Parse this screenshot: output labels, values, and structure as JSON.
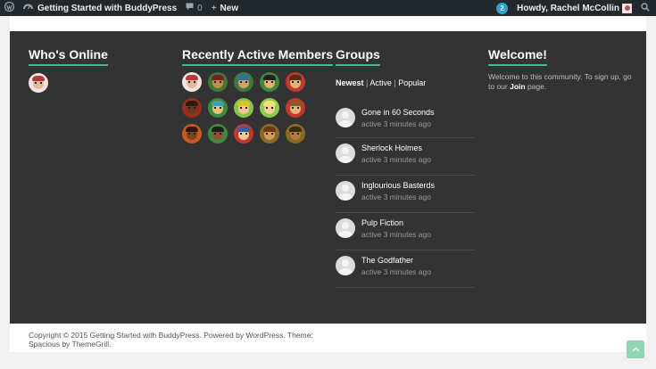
{
  "admin_bar": {
    "site_name": "Getting Started with BuddyPress",
    "comments_count": "0",
    "new_label": "New",
    "notifications_count": "2",
    "howdy": "Howdy, Rachel McCollin"
  },
  "widgets": {
    "whos_online": {
      "title": "Who's Online"
    },
    "recent_members": {
      "title": "Recently Active Members"
    },
    "groups": {
      "title": "Groups",
      "tab_newest": "Newest",
      "tab_active": "Active",
      "tab_popular": "Popular",
      "separator": "|",
      "items": [
        {
          "name": "Gone in 60 Seconds",
          "meta": "active 3 minutes ago"
        },
        {
          "name": "Sherlock Holmes",
          "meta": "active 3 minutes ago"
        },
        {
          "name": "Inglourious Basterds",
          "meta": "active 3 minutes ago"
        },
        {
          "name": "Pulp Fiction",
          "meta": "active 3 minutes ago"
        },
        {
          "name": "The Godfather",
          "meta": "active 3 minutes ago"
        }
      ]
    },
    "welcome": {
      "title": "Welcome!",
      "text_before": "Welcome to this community. To sign up, go to our ",
      "join_link": "Join",
      "text_after": " page."
    }
  },
  "footer": {
    "copyright": "Copyright © 2015 Getting Started with BuddyPress. Powered by WordPress. Theme: Spacious by ThemeGrill."
  },
  "colors": {
    "accent": "#3dbb8f",
    "footer_bg": "#333333",
    "admin_bar_bg": "#23282d"
  }
}
